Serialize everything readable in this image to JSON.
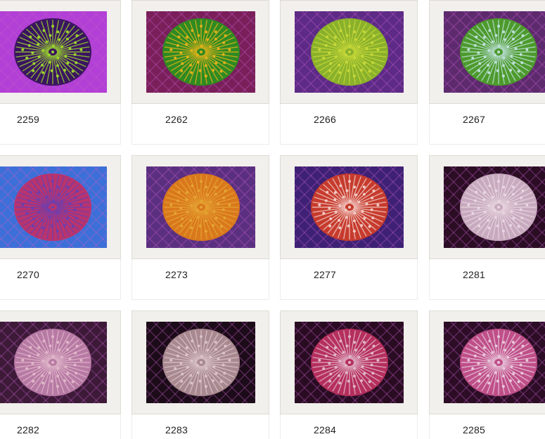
{
  "gallery": {
    "items": [
      {
        "id": "2259",
        "palette": [
          "#3a1560",
          "#9bd42e",
          "#b23fd6"
        ]
      },
      {
        "id": "2262",
        "palette": [
          "#2f8a22",
          "#e0b21a",
          "#7a1f5a"
        ]
      },
      {
        "id": "2266",
        "palette": [
          "#8ab12b",
          "#c7d83a",
          "#5d2a86"
        ]
      },
      {
        "id": "2267",
        "palette": [
          "#4d9a2c",
          "#bde0d8",
          "#5e2a6e"
        ]
      },
      {
        "id": "2270",
        "palette": [
          "#b8346e",
          "#6b3fb0",
          "#3d6fd8"
        ]
      },
      {
        "id": "2273",
        "palette": [
          "#d9781c",
          "#e5a433",
          "#5b2f80"
        ]
      },
      {
        "id": "2277",
        "palette": [
          "#c63b2d",
          "#f1c9c3",
          "#3e2174"
        ]
      },
      {
        "id": "2281",
        "palette": [
          "#c8aabf",
          "#e8d6e0",
          "#2b0d24"
        ]
      },
      {
        "id": "2282",
        "palette": [
          "#b77aa4",
          "#e0b7c9",
          "#3d1a38"
        ]
      },
      {
        "id": "2283",
        "palette": [
          "#a8898f",
          "#d9c3c9",
          "#1c0b18"
        ]
      },
      {
        "id": "2284",
        "palette": [
          "#b52f5d",
          "#e1b6c8",
          "#2a0c22"
        ]
      },
      {
        "id": "2285",
        "palette": [
          "#bf4f89",
          "#e9c7db",
          "#2c0d25"
        ]
      }
    ]
  }
}
